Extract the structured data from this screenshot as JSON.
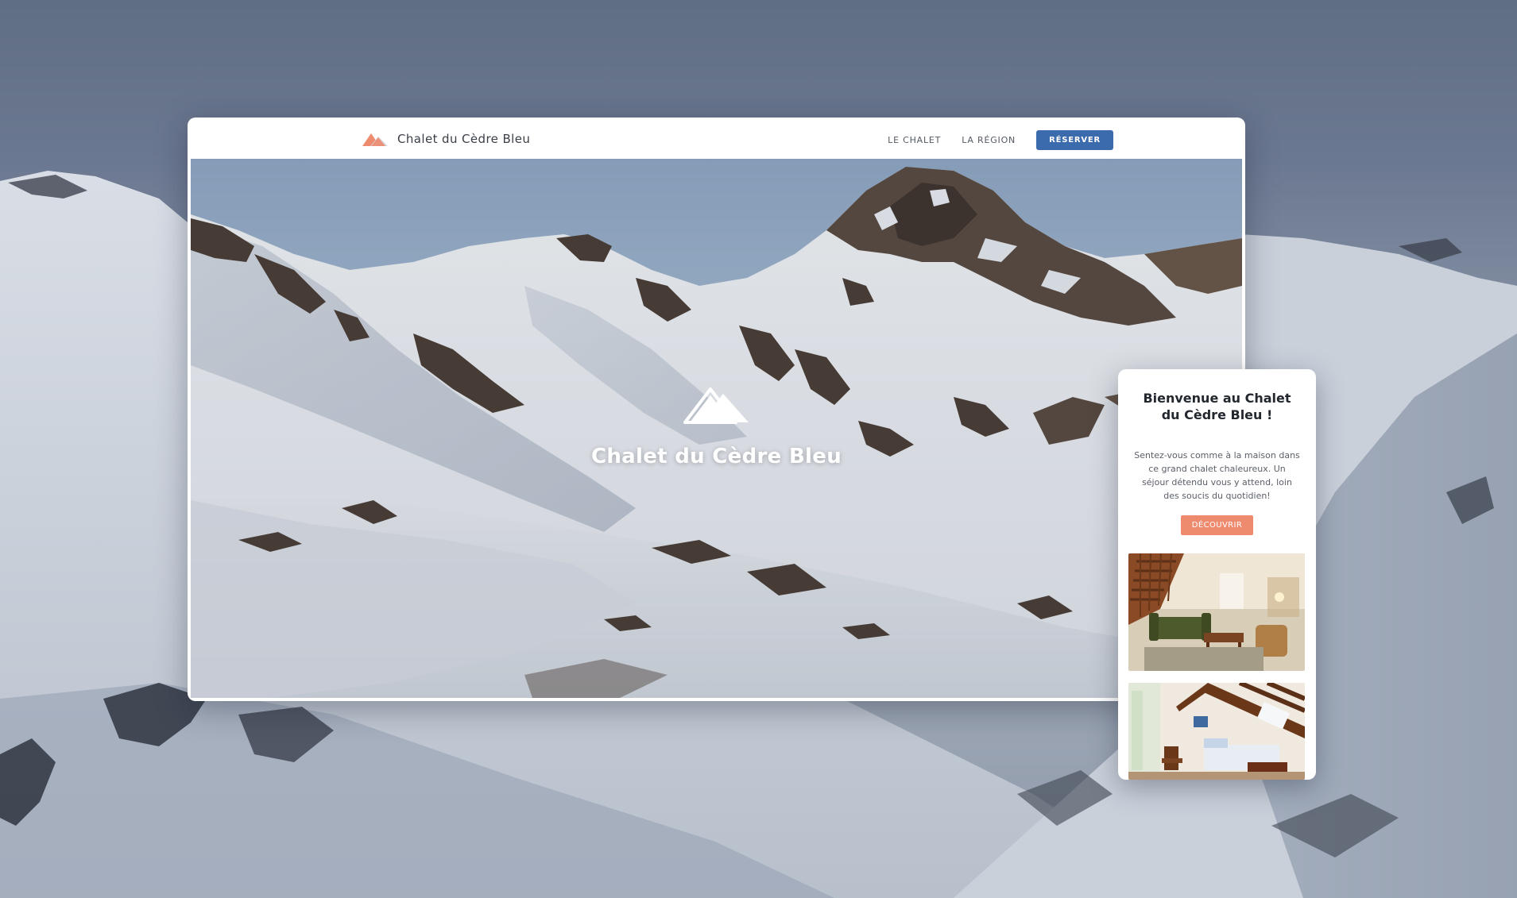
{
  "site": {
    "brand_name": "Chalet du Cèdre Bleu"
  },
  "nav": {
    "items": [
      {
        "label": "LE CHALET"
      },
      {
        "label": "LA RÉGION"
      }
    ],
    "cta_label": "RÉSERVER"
  },
  "hero": {
    "title": "Chalet du Cèdre Bleu"
  },
  "mobile": {
    "welcome_title": "Bienvenue au Chalet du Cèdre Bleu !",
    "welcome_text": "Sentez-vous comme à la maison dans ce grand chalet chaleureux. Un séjour détendu vous y attend, loin des soucis du quotidien!",
    "cta_label": "DÉCOUVRIR"
  },
  "colors": {
    "accent_orange": "#ee8a6e",
    "nav_cta_blue": "#3b6aad",
    "text_dark": "#23272e"
  },
  "icons": {
    "brand_logo": "mountain-logo-icon",
    "hero_logo": "mountain-logo-icon"
  }
}
